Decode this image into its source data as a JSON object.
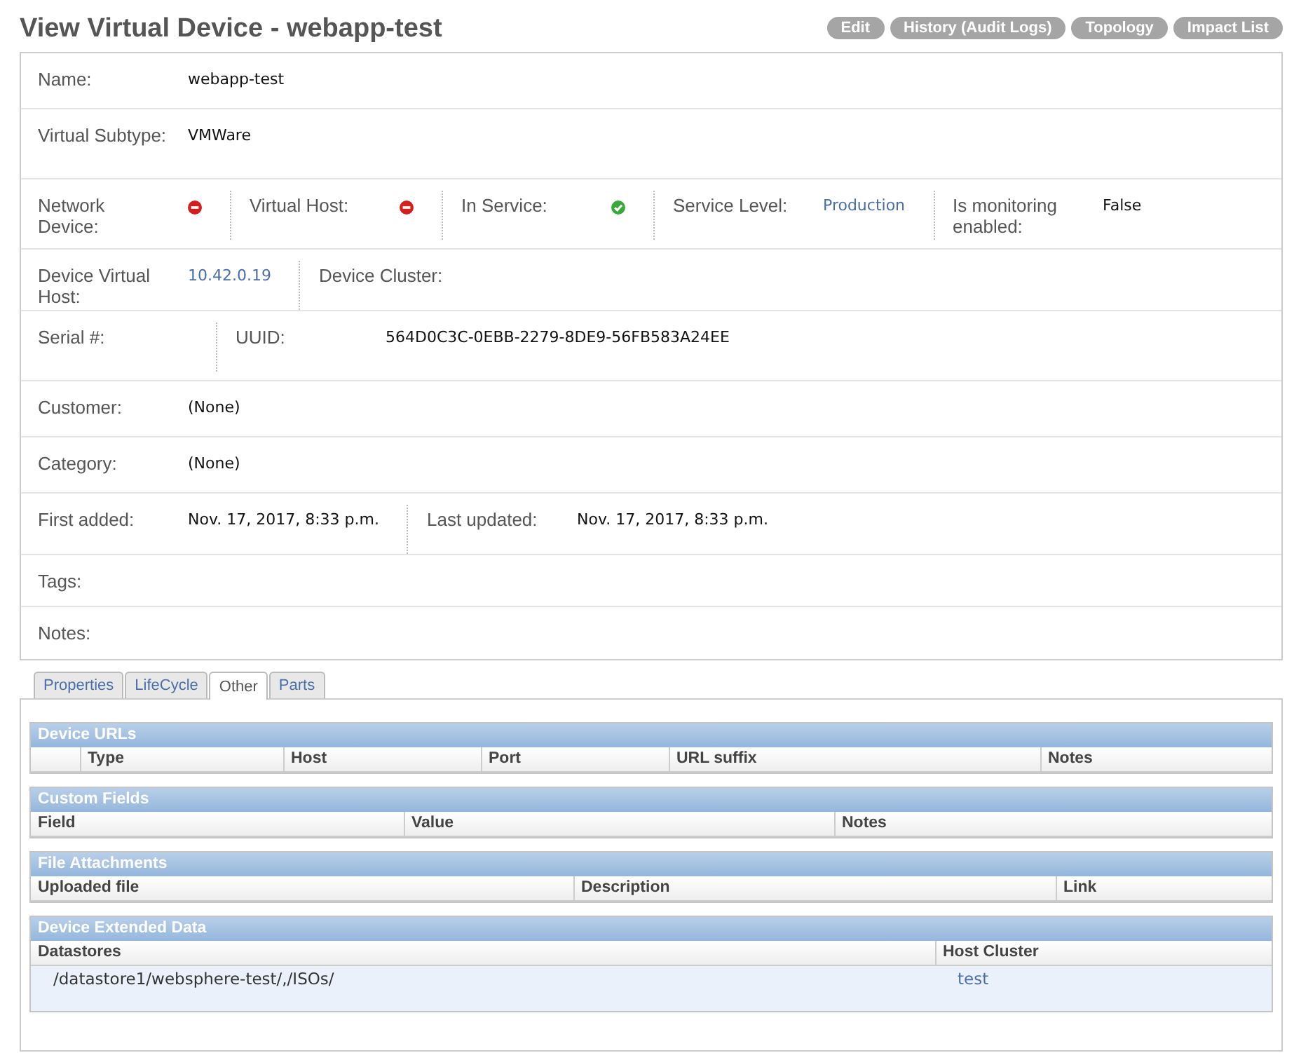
{
  "page_title": "View Virtual Device - webapp-test",
  "actions": [
    "Edit",
    "History (Audit Logs)",
    "Topology",
    "Impact List"
  ],
  "detail_rows": [
    {
      "fields": [
        {
          "label": "Name:",
          "kind": "text",
          "value": "webapp-test"
        }
      ]
    },
    {
      "fields": [
        {
          "label": "Virtual Subtype:",
          "kind": "text",
          "value": "VMWare"
        }
      ]
    },
    {
      "fields": [
        {
          "label": "Network Device:",
          "kind": "status",
          "ok": false
        },
        {
          "label": "Virtual Host:",
          "kind": "status",
          "ok": false
        },
        {
          "label": "In Service:",
          "kind": "status",
          "ok": true
        },
        {
          "label": "Service Level:",
          "kind": "link",
          "value": "Production"
        },
        {
          "label": "Is monitoring enabled:",
          "kind": "text",
          "value": "False"
        }
      ]
    },
    {
      "fields": [
        {
          "label": "Device Virtual Host:",
          "kind": "link",
          "value": "10.42.0.19"
        },
        {
          "label": "Device Cluster:",
          "kind": "text"
        }
      ]
    },
    {
      "fields": [
        {
          "label": "Serial #:",
          "kind": "text"
        },
        {
          "label": "UUID:",
          "kind": "text",
          "value": "564D0C3C-0EBB-2279-8DE9-56FB583A24EE"
        }
      ]
    },
    {
      "fields": [
        {
          "label": "Customer:",
          "kind": "text",
          "value": "(None)"
        }
      ]
    },
    {
      "fields": [
        {
          "label": "Category:",
          "kind": "text",
          "value": "(None)"
        }
      ]
    },
    {
      "fields": [
        {
          "label": "First added:",
          "kind": "text",
          "value": "Nov. 17, 2017, 8:33 p.m."
        },
        {
          "label": "Last updated:",
          "kind": "text",
          "value": "Nov. 17, 2017, 8:33 p.m."
        }
      ]
    },
    {
      "fields": [
        {
          "label": "Tags:",
          "kind": "text"
        }
      ]
    },
    {
      "fields": [
        {
          "label": "Notes:",
          "kind": "text"
        }
      ]
    }
  ],
  "tabs": [
    {
      "label": "Properties",
      "selected": false
    },
    {
      "label": "LifeCycle",
      "selected": false
    },
    {
      "label": "Other",
      "selected": true
    },
    {
      "label": "Parts",
      "selected": false
    }
  ],
  "sections": [
    {
      "title": "Device URLs",
      "columns": [
        {},
        {
          "label": "Type"
        },
        {
          "label": "Host"
        },
        {
          "label": "Port"
        },
        {
          "label": "URL suffix"
        },
        {
          "label": "Notes"
        }
      ]
    },
    {
      "title": "Custom Fields",
      "columns": [
        {
          "label": "Field"
        },
        {
          "label": "Value"
        },
        {
          "label": "Notes"
        }
      ]
    },
    {
      "title": "File Attachments",
      "columns": [
        {
          "label": "Uploaded file"
        },
        {
          "label": "Description"
        },
        {
          "label": "Link"
        }
      ]
    },
    {
      "title": "Device Extended Data",
      "columns": [
        {
          "label": "Datastores"
        },
        {
          "label": "Host Cluster"
        }
      ],
      "rows": [
        [
          {
            "kind": "text",
            "text": "/datastore1/websphere-test/,/ISOs/"
          },
          {
            "kind": "link",
            "text": "test"
          }
        ]
      ]
    }
  ]
}
